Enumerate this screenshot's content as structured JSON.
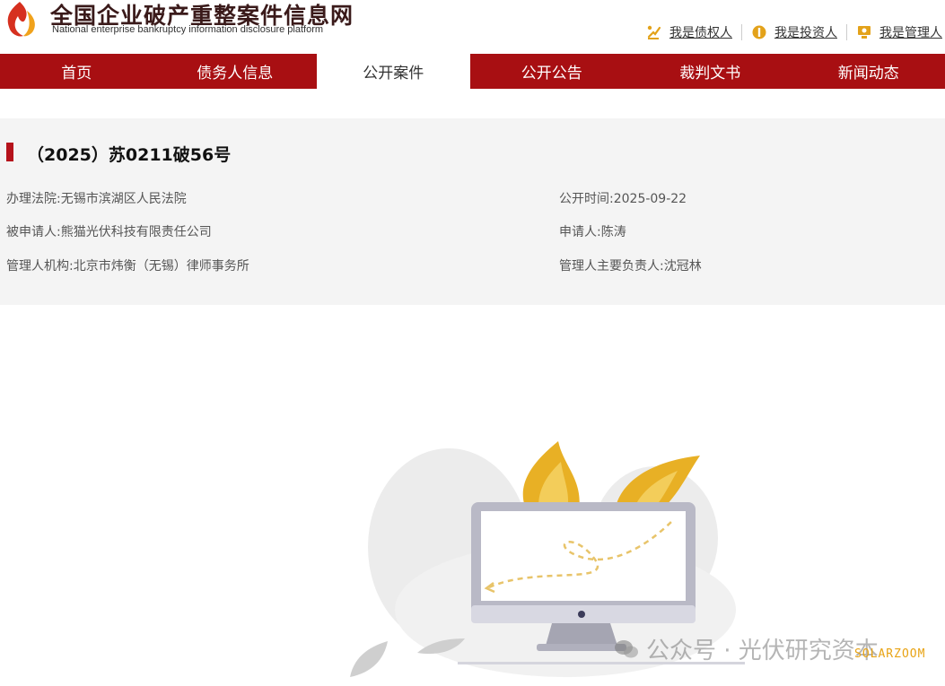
{
  "header": {
    "site_title": "全国企业破产重整案件信息网",
    "site_subtitle": "National enterprise bankruptcy  information disclosure platform",
    "user_links": [
      {
        "label": "我是债权人",
        "icon": "creditor-icon"
      },
      {
        "label": "我是投资人",
        "icon": "investor-icon"
      },
      {
        "label": "我是管理人",
        "icon": "administrator-icon"
      }
    ]
  },
  "nav": {
    "items": [
      {
        "label": "首页",
        "active": false
      },
      {
        "label": "债务人信息",
        "active": false
      },
      {
        "label": "公开案件",
        "active": true
      },
      {
        "label": "公开公告",
        "active": false
      },
      {
        "label": "裁判文书",
        "active": false
      },
      {
        "label": "新闻动态",
        "active": false
      }
    ]
  },
  "case": {
    "title": "（2025）苏0211破56号",
    "court_label": "办理法院:",
    "court": "无锡市滨湖区人民法院",
    "publish_label": "公开时间:",
    "publish_date": "2025-09-22",
    "respondent_label": "被申请人:",
    "respondent": "熊猫光伏科技有限责任公司",
    "applicant_label": "申请人:",
    "applicant": "陈涛",
    "admin_org_label": "管理人机构:",
    "admin_org": "北京市炜衡（无锡）律师事务所",
    "admin_lead_label": "管理人主要负责人:",
    "admin_lead": "沈冠林"
  },
  "watermark": {
    "text": "公众号 · 光伏研究资本",
    "brand": "SOLARZOOM"
  },
  "colors": {
    "nav_bg": "#a80f12",
    "accent": "#b5121b",
    "panel_bg": "#f4f4f4",
    "flame": "#e8b025"
  }
}
